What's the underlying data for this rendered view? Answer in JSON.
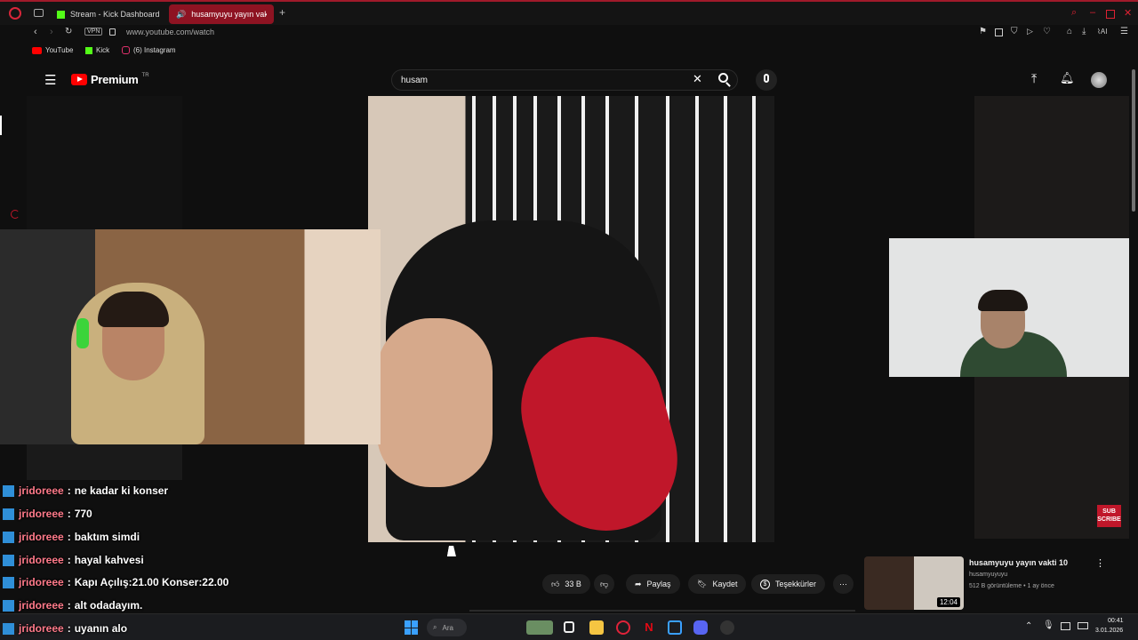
{
  "browser": {
    "tabs": [
      {
        "label": "Stream - Kick Dashboard",
        "active": false
      },
      {
        "label": "husamyuyu yayın vakti",
        "active": true
      }
    ],
    "address": "www.youtube.com/watch",
    "vpn_label": "VPN",
    "ai_label": "AI",
    "bookmarks": [
      {
        "label": "YouTube",
        "icon": "youtube-icon"
      },
      {
        "label": "Kick",
        "icon": "kick-icon"
      },
      {
        "label": "(6) Instagram",
        "icon": "instagram-icon"
      }
    ]
  },
  "youtube": {
    "logo_text": "Premium",
    "logo_region": "TR",
    "search_value": "husam"
  },
  "chat": [
    {
      "user": "jridoreee",
      "message": "ne kadar ki konser"
    },
    {
      "user": "jridoreee",
      "message": "770"
    },
    {
      "user": "jridoreee",
      "message": "baktım simdi"
    },
    {
      "user": "jridoreee",
      "message": "hayal kahvesi"
    },
    {
      "user": "jridoreee",
      "message": "Kapı Açılış:21.00 Konser:22.00"
    },
    {
      "user": "jridoreee",
      "message": "alt odadayım."
    },
    {
      "user": "jridoreee",
      "message": "uyanın alo"
    }
  ],
  "actions": {
    "like_count": "33 B",
    "share": "Paylaş",
    "save": "Kaydet",
    "thanks": "Teşekkürler"
  },
  "recommendation": {
    "title": "husamyuyu yayın vakti 10",
    "channel": "husamyuyuyu",
    "meta": "512 B görüntüleme • 1 ay önce",
    "duration": "12:04"
  },
  "subscribe_badge": "SUB SCRIBE",
  "taskbar": {
    "search_label": "Ara",
    "time": "00:41",
    "date": "3.01.2026"
  },
  "colors": {
    "accent_red": "#c0172a",
    "chat_user": "#ff7a8a",
    "kick_green": "#53fc18"
  }
}
